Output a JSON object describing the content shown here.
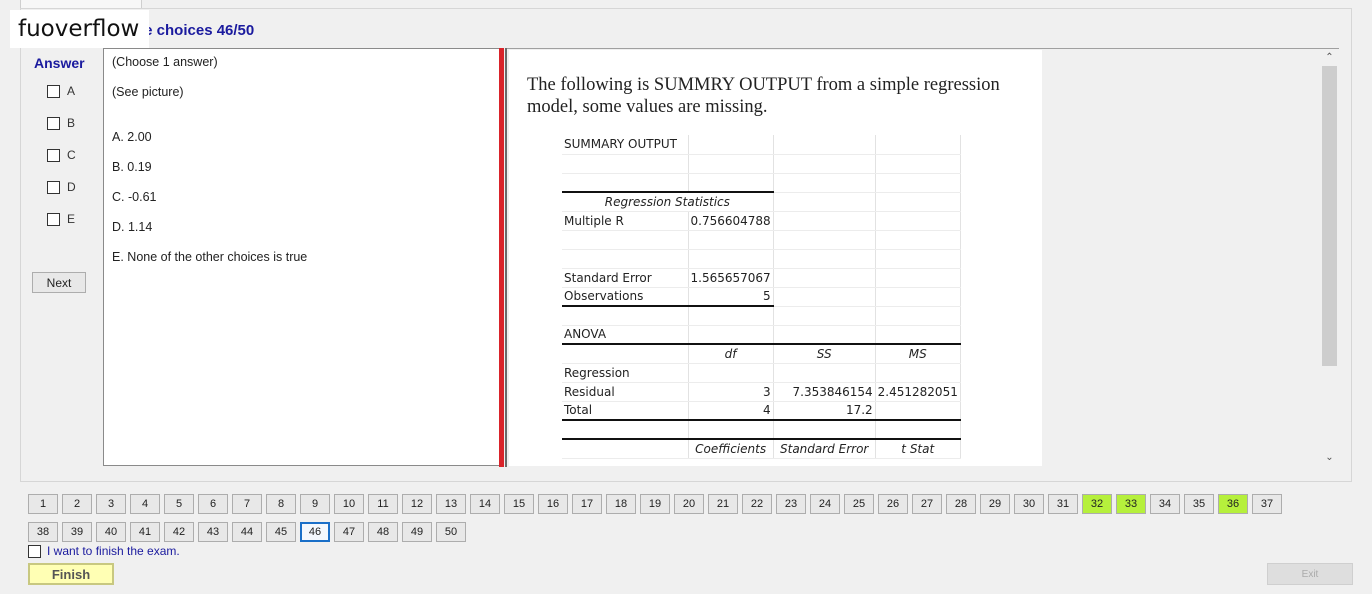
{
  "watermark": "fuoverflow",
  "section_title": "le choices 46/50",
  "answer_panel": {
    "label": "Answer",
    "options": [
      "A",
      "B",
      "C",
      "D",
      "E"
    ],
    "next_label": "Next"
  },
  "question": {
    "instruction": "(Choose 1 answer)",
    "see_picture": "(See picture)",
    "choices": [
      {
        "key": "A.",
        "text": "2.00"
      },
      {
        "key": "B.",
        "text": "0.19"
      },
      {
        "key": "C.",
        "text": "-0.61"
      },
      {
        "key": "D.",
        "text": "1.14"
      },
      {
        "key": "E.",
        "text": "None of the other choices is true"
      }
    ]
  },
  "image": {
    "intro": "The following is SUMMRY OUTPUT from a simple regression model, some values are missing.",
    "table_rows": [
      [
        "SUMMARY OUTPUT",
        "",
        "",
        ""
      ],
      [
        "",
        "",
        "",
        ""
      ],
      [
        "",
        "",
        "",
        ""
      ],
      [
        "Regression Statistics",
        "",
        "",
        ""
      ],
      [
        "Multiple R",
        "0.756604788",
        "",
        ""
      ],
      [
        "",
        "",
        "",
        ""
      ],
      [
        "",
        "",
        "",
        ""
      ],
      [
        "Standard Error",
        "1.565657067",
        "",
        ""
      ],
      [
        "Observations",
        "5",
        "",
        ""
      ],
      [
        "",
        "",
        "",
        ""
      ],
      [
        "ANOVA",
        "",
        "",
        ""
      ],
      [
        "",
        "df",
        "SS",
        "MS"
      ],
      [
        "Regression",
        "",
        "",
        ""
      ],
      [
        "Residual",
        "3",
        "7.353846154",
        "2.451282051"
      ],
      [
        "Total",
        "4",
        "17.2",
        ""
      ],
      [
        "",
        "",
        "",
        ""
      ],
      [
        "",
        "Coefficients",
        "Standard Error",
        "t Stat"
      ]
    ]
  },
  "navigation": {
    "questions": [
      "1",
      "2",
      "3",
      "4",
      "5",
      "6",
      "7",
      "8",
      "9",
      "10",
      "11",
      "12",
      "13",
      "14",
      "15",
      "16",
      "17",
      "18",
      "19",
      "20",
      "21",
      "22",
      "23",
      "24",
      "25",
      "26",
      "27",
      "28",
      "29",
      "30",
      "31",
      "32",
      "33",
      "34",
      "35",
      "36",
      "37",
      "38",
      "39",
      "40",
      "41",
      "42",
      "43",
      "44",
      "45",
      "46",
      "47",
      "48",
      "49",
      "50"
    ],
    "answered": [
      "32",
      "33",
      "36"
    ],
    "current": "46"
  },
  "footer": {
    "finish_check_label": "I want to finish the exam.",
    "finish_label": "Finish",
    "exit_label": "Exit"
  },
  "colors": {
    "title_blue": "#1a1a9e",
    "answered_green": "#b6f03c",
    "divider_red": "#d9232a",
    "finish_yellow": "#ffffb4"
  }
}
